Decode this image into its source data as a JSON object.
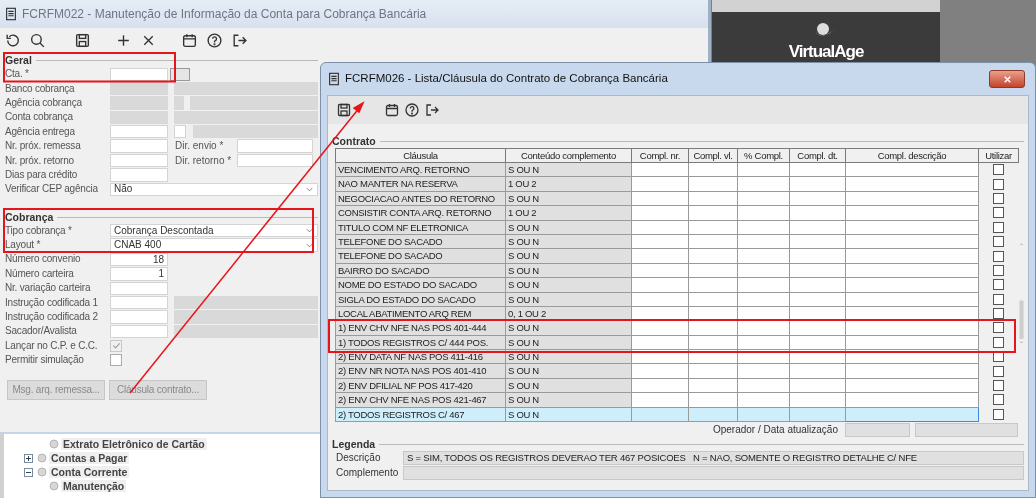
{
  "background_window": {
    "title": "FCRFM022 - Manutenção de Informação da Conta para Cobrança Bancária",
    "sections": [
      {
        "legend": "Geral",
        "rows": [
          {
            "label": "Cta. *",
            "kind": "lookup"
          },
          {
            "label": "Banco cobrança",
            "kind": "readonly_ref"
          },
          {
            "label": "Agência cobrança",
            "kind": "readonly_split"
          },
          {
            "label": "Conta cobrança",
            "kind": "readonly_ref"
          },
          {
            "label": "Agência entrega",
            "kind": "editable_split"
          },
          {
            "label": "Nr. próx. remessa",
            "kind": "dir",
            "side_label": "Dir. envio *"
          },
          {
            "label": "Nr. próx. retorno",
            "kind": "dir",
            "side_label": "Dir. retorno *"
          },
          {
            "label": "Dias para crédito",
            "kind": "plain"
          },
          {
            "label": "Verificar CEP agência",
            "kind": "select",
            "value": "Não"
          }
        ]
      },
      {
        "legend": "Cobrança",
        "rows": [
          {
            "label": "Tipo cobrança *",
            "kind": "select",
            "value": "Cobrança Descontada"
          },
          {
            "label": "Layout *",
            "kind": "select",
            "value": "CNAB 400"
          },
          {
            "label": "Número convenio",
            "kind": "plain",
            "value": "18"
          },
          {
            "label": "Número carteira",
            "kind": "plain",
            "value": "1"
          },
          {
            "label": "Nr. variação carteira",
            "kind": "plain"
          },
          {
            "label": "Instrução codificada 1",
            "kind": "ref"
          },
          {
            "label": "Instrução codificada 2",
            "kind": "ref"
          },
          {
            "label": "Sacador/Avalista",
            "kind": "ref"
          },
          {
            "label": "Lançar no C.P. e C.C.",
            "kind": "checkbox",
            "checked": true,
            "disabled": true
          },
          {
            "label": "Permitir simulação",
            "kind": "checkbox",
            "checked": false,
            "disabled": false
          }
        ]
      }
    ],
    "buttons": [
      {
        "label": "Msg. arq. remessa...",
        "disabled": true
      },
      {
        "label": "Cláusula contrato...",
        "disabled": true
      }
    ]
  },
  "tree": [
    {
      "children": [
        {
          "label": "Extrato Eletrônico de Cartão"
        }
      ]
    },
    {
      "label": "Contas a Pagar",
      "expanded": false
    },
    {
      "label": "Conta Corrente",
      "expanded": true,
      "children": [
        {
          "label": "Manutenção"
        }
      ]
    }
  ],
  "logo": {
    "text": "VirtualAge"
  },
  "contract_window": {
    "title": "FCRFM026 - Lista/Cláusula do Contrato de Cobrança Bancária",
    "legend": "Contrato",
    "columns": [
      "Cláusula",
      "Conteúdo complemento",
      "Compl. nr.",
      "Compl. vl.",
      "% Compl.",
      "Compl. dt.",
      "Compl. descrição",
      "Utilizar"
    ],
    "rows": [
      {
        "clause": "VENCIMENTO ARQ. RETORNO",
        "content": "S OU N",
        "use": false,
        "selected": false
      },
      {
        "clause": "NAO MANTER NA RESERVA",
        "content": "1 OU 2",
        "use": false,
        "selected": false
      },
      {
        "clause": "NEGOCIACAO ANTES DO RETORNO",
        "content": "S OU N",
        "use": false,
        "selected": false
      },
      {
        "clause": "CONSISTIR CONTA ARQ. RETORNO",
        "content": "1 OU 2",
        "use": false,
        "selected": false
      },
      {
        "clause": "TITULO COM NF ELETRONICA",
        "content": "S OU N",
        "use": false,
        "selected": false
      },
      {
        "clause": "TELEFONE DO SACADO",
        "content": "S OU N",
        "use": false,
        "selected": false
      },
      {
        "clause": "TELEFONE DO SACADO",
        "content": "S OU N",
        "use": false,
        "selected": false
      },
      {
        "clause": "BAIRRO DO SACADO",
        "content": "S OU N",
        "use": false,
        "selected": false
      },
      {
        "clause": "NOME DO ESTADO DO SACADO",
        "content": "S OU N",
        "use": false,
        "selected": false
      },
      {
        "clause": "SIGLA DO ESTADO DO SACADO",
        "content": "S OU N",
        "use": false,
        "selected": false
      },
      {
        "clause": "LOCAL ABATIMENTO ARQ REM",
        "content": "0, 1 OU 2",
        "use": false,
        "selected": false
      },
      {
        "clause": "1) ENV CHV NFE NAS POS 401-444",
        "content": "S OU N",
        "use": false,
        "selected": false
      },
      {
        "clause": "1) TODOS REGISTROS C/ 444 POS.",
        "content": "S OU N",
        "use": false,
        "selected": false
      },
      {
        "clause": "2) ENV DATA NF NAS POS 411-416",
        "content": "S OU N",
        "use": false,
        "selected": false
      },
      {
        "clause": "2) ENV NR NOTA NAS POS 401-410",
        "content": "S OU N",
        "use": false,
        "selected": false
      },
      {
        "clause": "2) ENV DFILIAL NF POS 417-420",
        "content": "S OU N",
        "use": false,
        "selected": false
      },
      {
        "clause": "2) ENV CHV NFE NAS POS 421-467",
        "content": "S OU N",
        "use": false,
        "selected": false
      },
      {
        "clause": "2) TODOS REGISTROS C/ 467",
        "content": "S OU N",
        "use": false,
        "selected": true
      }
    ],
    "operator_label": "Operador / Data atualização",
    "legend_group": {
      "legend": "Legenda",
      "fields": [
        {
          "label": "Descrição",
          "value": "S = SIM, TODOS OS REGISTROS DEVERAO TER 467 POSICOES   N = NAO, SOMENTE O REGISTRO DETALHE C/ NFE"
        },
        {
          "label": "Complemento"
        }
      ]
    }
  }
}
